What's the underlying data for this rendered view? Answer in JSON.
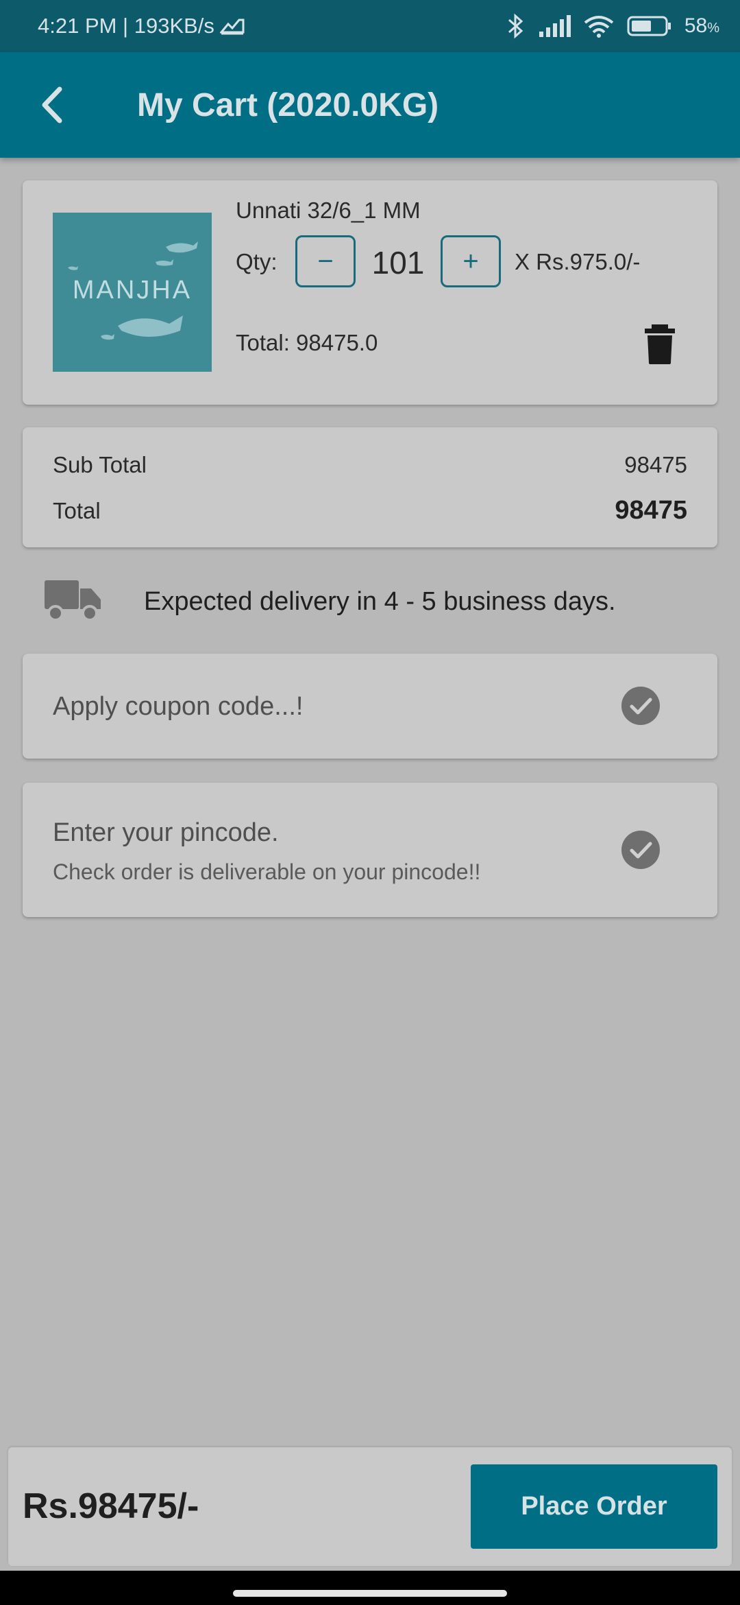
{
  "status_bar": {
    "time_speed": "4:21 PM | 193KB/s",
    "battery": "58",
    "battery_unit": "%"
  },
  "app_bar": {
    "title": "My Cart (2020.0KG)"
  },
  "cart_item": {
    "image_text": "MANJHA",
    "name": "Unnati 32/6_1 MM",
    "qty_label": "Qty:",
    "minus": "−",
    "quantity": "101",
    "plus": "+",
    "unit_price": "X Rs.975.0/-",
    "total": "Total: 98475.0"
  },
  "totals": {
    "subtotal_label": "Sub Total",
    "subtotal_value": "98475",
    "total_label": "Total",
    "total_value": "98475"
  },
  "delivery": {
    "text": "Expected delivery in 4 - 5 business days."
  },
  "coupon": {
    "placeholder": "Apply coupon code...!"
  },
  "pincode": {
    "title": "Enter your pincode.",
    "subtitle": "Check order is deliverable on your pincode!!"
  },
  "footer": {
    "grand_total": "Rs.98475/-",
    "place_order": "Place Order"
  },
  "icons": {
    "back": "arrow-back-icon",
    "trash": "trash-icon",
    "truck": "truck-icon",
    "check": "check-circle-icon"
  },
  "colors": {
    "primary": "#006f86",
    "status_bar": "#0d5a6b",
    "background": "#b8b8b8",
    "card": "#c9c9c9"
  }
}
